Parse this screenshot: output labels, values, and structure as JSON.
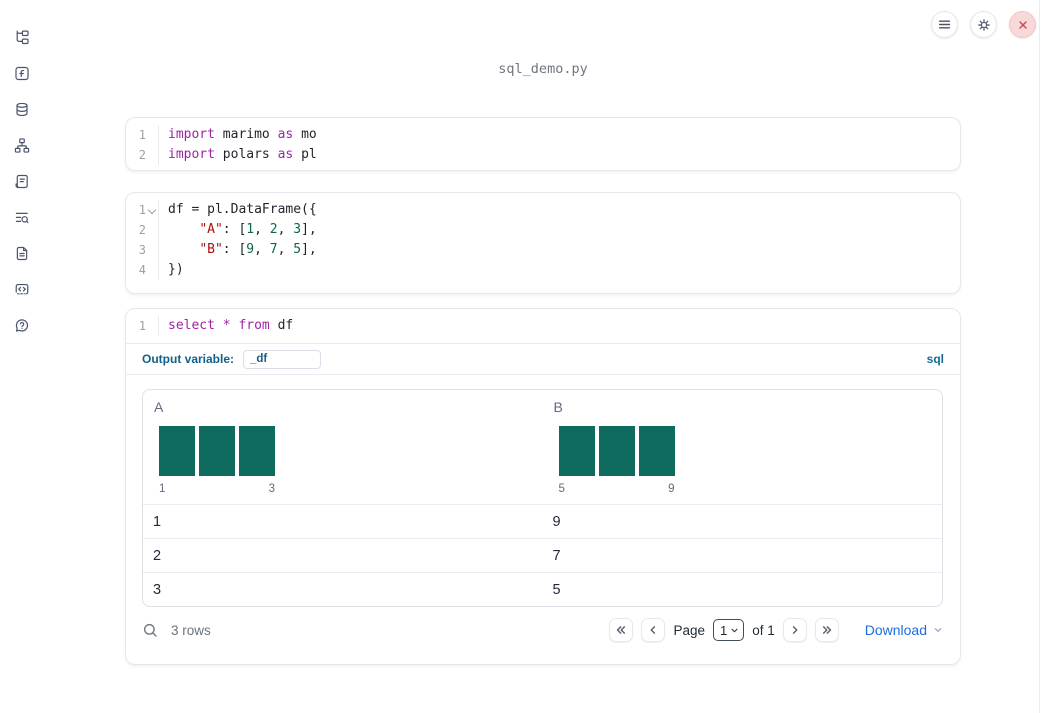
{
  "window": {
    "title": "sql_demo.py"
  },
  "sidebar": {
    "items": [
      {
        "name": "file-explorer"
      },
      {
        "name": "variables"
      },
      {
        "name": "data-sources"
      },
      {
        "name": "dependency-graph"
      },
      {
        "name": "logs"
      },
      {
        "name": "table-of-contents"
      },
      {
        "name": "documentation"
      },
      {
        "name": "snippets"
      },
      {
        "name": "help"
      }
    ]
  },
  "topbar": {
    "buttons": [
      {
        "name": "menu"
      },
      {
        "name": "settings"
      },
      {
        "name": "shutdown"
      }
    ]
  },
  "cells": [
    {
      "type": "python",
      "lines": [
        {
          "num": "1",
          "fold": false,
          "tokens": [
            [
              "kw",
              "import"
            ],
            [
              "pl",
              " marimo "
            ],
            [
              "kw",
              "as"
            ],
            [
              "pl",
              " mo"
            ]
          ]
        },
        {
          "num": "2",
          "fold": false,
          "tokens": [
            [
              "kw",
              "import"
            ],
            [
              "pl",
              " polars "
            ],
            [
              "kw",
              "as"
            ],
            [
              "pl",
              " pl"
            ]
          ]
        }
      ]
    },
    {
      "type": "python",
      "lines": [
        {
          "num": "1",
          "fold": true,
          "tokens": [
            [
              "pl",
              "df = pl.DataFrame({"
            ]
          ]
        },
        {
          "num": "2",
          "fold": false,
          "tokens": [
            [
              "pl",
              "    "
            ],
            [
              "str",
              "\"A\""
            ],
            [
              "pl",
              ": ["
            ],
            [
              "num",
              "1"
            ],
            [
              "pl",
              ", "
            ],
            [
              "num",
              "2"
            ],
            [
              "pl",
              ", "
            ],
            [
              "num",
              "3"
            ],
            [
              "pl",
              "],"
            ]
          ]
        },
        {
          "num": "3",
          "fold": false,
          "tokens": [
            [
              "pl",
              "    "
            ],
            [
              "str",
              "\"B\""
            ],
            [
              "pl",
              ": ["
            ],
            [
              "num",
              "9"
            ],
            [
              "pl",
              ", "
            ],
            [
              "num",
              "7"
            ],
            [
              "pl",
              ", "
            ],
            [
              "num",
              "5"
            ],
            [
              "pl",
              "],"
            ]
          ]
        },
        {
          "num": "4",
          "fold": false,
          "tokens": [
            [
              "pl",
              "})"
            ]
          ]
        }
      ]
    },
    {
      "type": "sql",
      "lines": [
        {
          "num": "1",
          "fold": false,
          "tokens": [
            [
              "kw",
              "select"
            ],
            [
              "pl",
              " "
            ],
            [
              "kw",
              "*"
            ],
            [
              "pl",
              " "
            ],
            [
              "kw",
              "from"
            ],
            [
              "pl",
              " df"
            ]
          ]
        }
      ],
      "output_variable_label": "Output variable:",
      "output_variable_value": "_df",
      "language_badge": "sql"
    }
  ],
  "table": {
    "columns": [
      {
        "name": "A",
        "hist": {
          "bins": [
            1,
            1,
            1
          ],
          "min_label": "1",
          "max_label": "3"
        }
      },
      {
        "name": "B",
        "hist": {
          "bins": [
            1,
            1,
            1
          ],
          "min_label": "5",
          "max_label": "9"
        }
      }
    ],
    "rows": [
      [
        "1",
        "9"
      ],
      [
        "2",
        "7"
      ],
      [
        "3",
        "5"
      ]
    ],
    "footer": {
      "row_count": "3 rows",
      "page_label": "Page",
      "page_value": "1",
      "of_label": "of 1",
      "download_label": "Download"
    }
  },
  "colors": {
    "accent": "#12618b",
    "histogram_bar": "#0e6b5e",
    "link": "#1b6ede",
    "keyword": "#a023a6",
    "string": "#aa1111",
    "number": "#116644"
  }
}
